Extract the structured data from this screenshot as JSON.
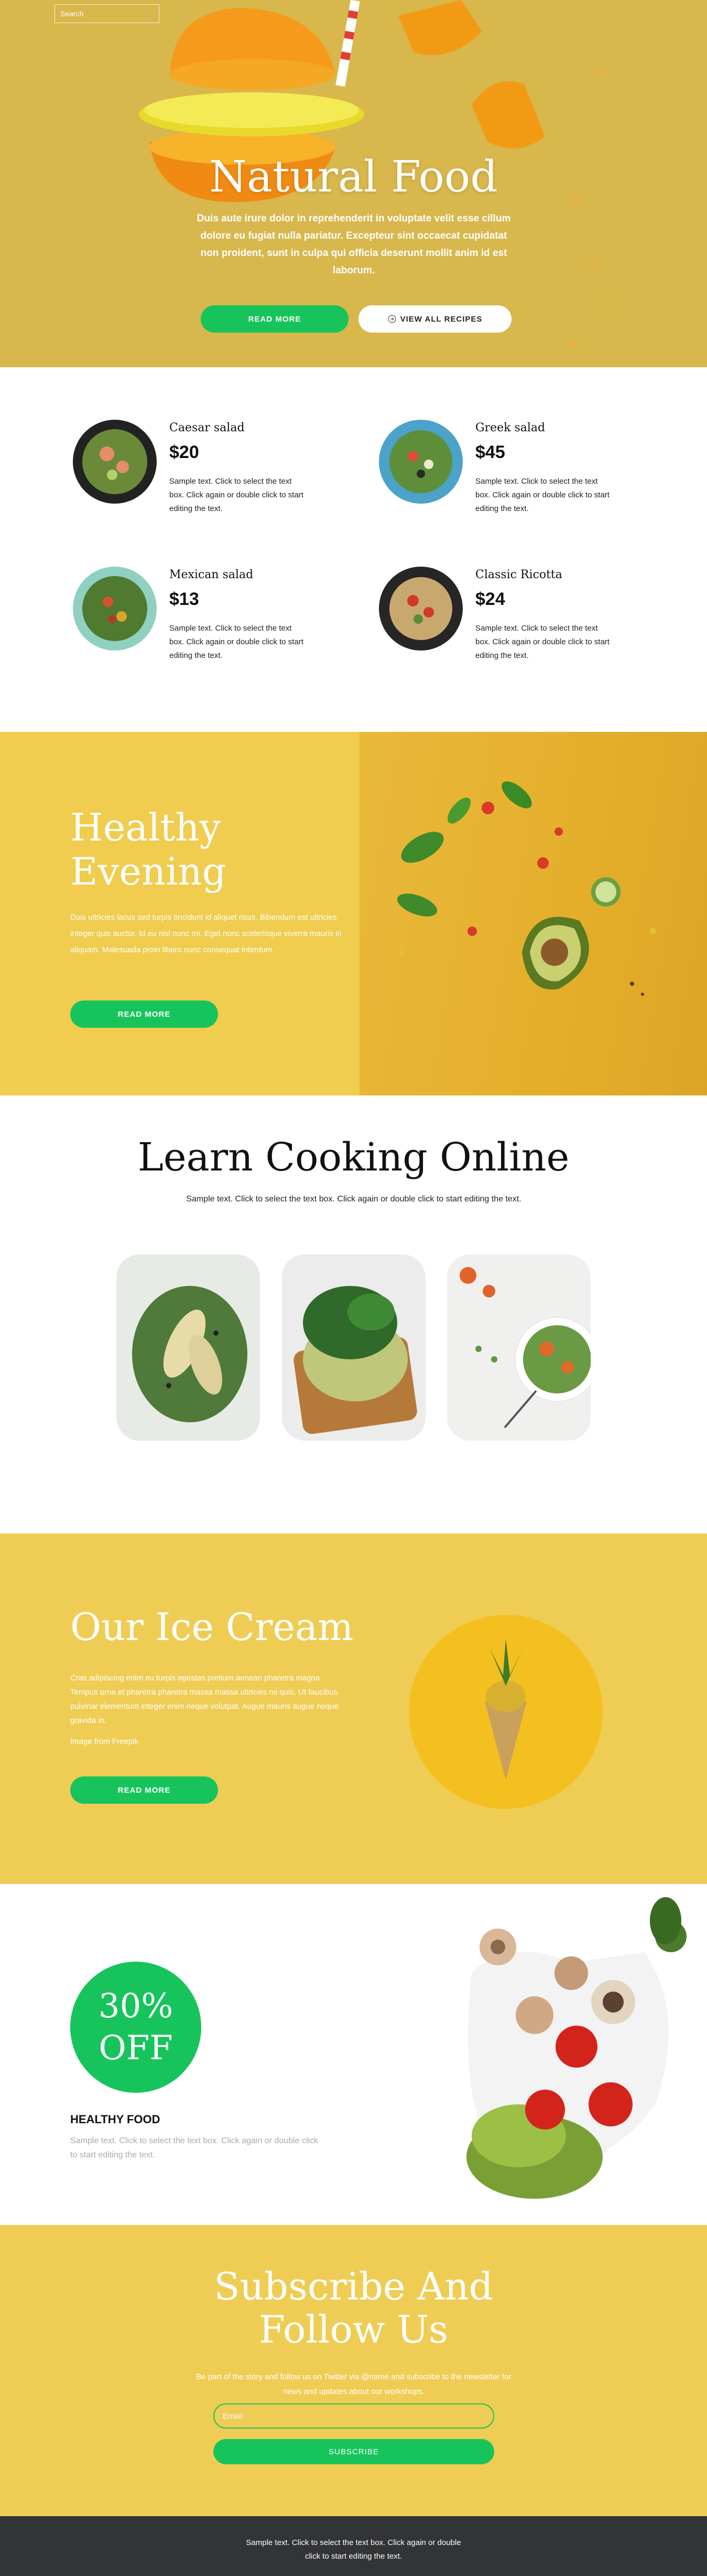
{
  "search": {
    "placeholder": "Search"
  },
  "hero": {
    "title": "Natural Food",
    "text": "Duis aute irure dolor in reprehenderit in voluptate velit esse cillum dolore eu fugiat nulla pariatur. Excepteur sint occaecat cupidatat non proident, sunt in culpa qui officia deserunt mollit anim id est laborum.",
    "primary_label": "READ MORE",
    "secondary_label": "VIEW ALL RECIPES"
  },
  "menu": {
    "items": [
      {
        "name": "Caesar salad",
        "price": "$20",
        "desc": "Sample text. Click to select the text box. Click again or double click to start editing the text."
      },
      {
        "name": "Greek salad",
        "price": "$45",
        "desc": "Sample text. Click to select the text box. Click again or double click to start editing the text."
      },
      {
        "name": "Mexican salad",
        "price": "$13",
        "desc": "Sample text. Click to select the text box. Click again or double click to start editing the text."
      },
      {
        "name": "Classic Ricotta",
        "price": "$24",
        "desc": "Sample text. Click to select the text box. Click again or double click to start editing the text."
      }
    ]
  },
  "healthy": {
    "title_line1": "Healthy",
    "title_line2": "Evening",
    "text": "Duis ultricies lacus sed turpis tincidunt id aliquet risus. Bibendum est ultricies integer quis auctor. Id eu nisl nunc mi. Eget nunc scelerisque viverra mauris in aliquam. Malesuada proin libero nunc consequat interdum.",
    "button_label": "READ MORE"
  },
  "learn": {
    "title": "Learn Cooking Online",
    "text": "Sample text. Click to select the text box. Click again or double click to start editing the text."
  },
  "ice": {
    "title": "Our Ice Cream",
    "text": "Cras adipiscing enim eu turpis egestas pretium aenean pharetra magna. Tempus urna et pharetra pharetra massa massa ultricies mi quis. Ut faucibus pulvinar elementum integer enim neque volutpat. Augue mauris augue neque gravida in.",
    "credit_prefix": "Image from",
    "credit_link": "Freepik",
    "button_label": "READ MORE"
  },
  "offer": {
    "percent": "30%",
    "label": "OFF",
    "heading": "HEALTHY FOOD",
    "text": "Sample text. Click to select the text box. Click again or double click to start editing the text."
  },
  "subscribe": {
    "title_line1": "Subscribe And",
    "title_line2": "Follow Us",
    "text": "Be part of the story and follow us on Twitter via @name and subscribe to the newsletter for news and updates about our workshops.",
    "email_placeholder": "Email",
    "button_label": "SUBSCRIBE"
  },
  "footer": {
    "line1": "Sample text. Click to select the text box. Click again or double",
    "line2": "click to start editing the text."
  },
  "colors": {
    "accent_green": "#17c45c",
    "hero_bg": "#d8b74c",
    "yellow_bg": "#efcd55",
    "footer_bg": "#333436"
  }
}
